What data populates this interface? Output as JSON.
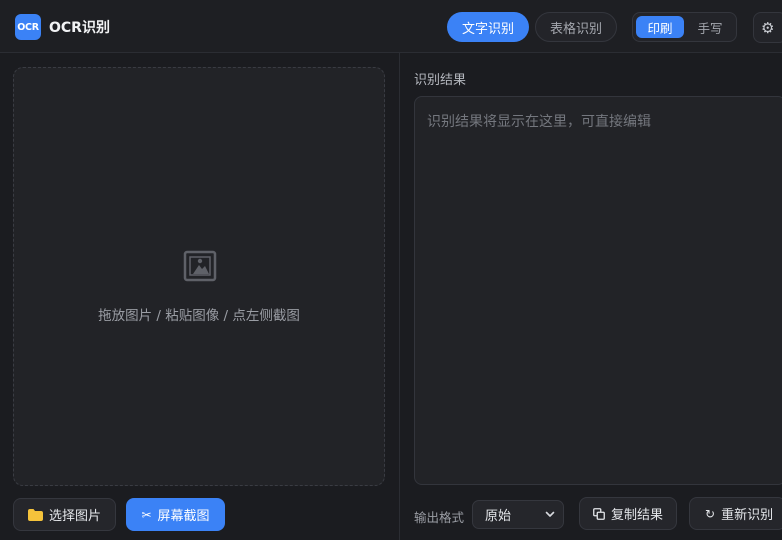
{
  "header": {
    "logo_text": "OCR",
    "title": "OCR识别",
    "modes": {
      "text": "文字识别",
      "table": "表格识别"
    },
    "script_toggle": {
      "print": "印刷",
      "handwriting": "手写"
    },
    "settings_icon": "gear-icon"
  },
  "left": {
    "drop_hint": "拖放图片 / 粘贴图像 / 点左侧截图",
    "drop_icon": "image-icon",
    "select_button": "选择图片",
    "select_icon": "folder-icon",
    "screenshot_button": "屏幕截图",
    "screenshot_icon": "scissors-icon"
  },
  "right": {
    "result_label": "识别结果",
    "result_placeholder": "识别结果将显示在这里，可直接编辑",
    "format_label": "输出格式",
    "format_value": "原始",
    "copy_button": "复制结果",
    "copy_icon": "copy-icon",
    "retry_button": "重新识别",
    "retry_icon": "refresh-icon"
  },
  "colors": {
    "accent": "#3b82f6",
    "background": "#1b1c20",
    "panel": "#222327",
    "folder": "#f5c33b"
  }
}
